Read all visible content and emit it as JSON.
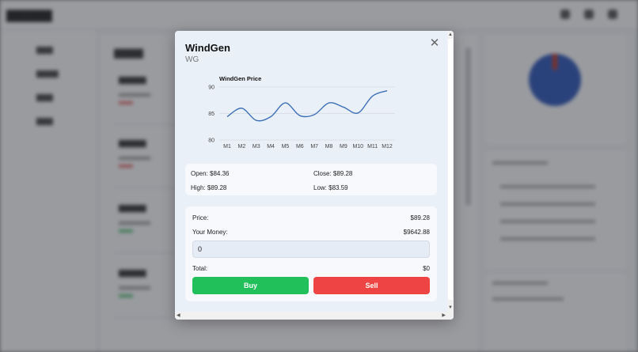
{
  "modal": {
    "title": "WindGen",
    "symbol": "WG",
    "close_glyph": "✕",
    "ohlc": {
      "open": "Open: $84.36",
      "close": "Close: $89.28",
      "high": "High: $89.28",
      "low": "Low: $83.59"
    },
    "trade": {
      "price_label": "Price:",
      "price_value": "$89.28",
      "money_label": "Your Money:",
      "money_value": "$9642.88",
      "quantity_value": "0",
      "total_label": "Total:",
      "total_value": "$0",
      "buy_label": "Buy",
      "sell_label": "Sell"
    }
  },
  "chart_data": {
    "type": "line",
    "title": "WindGen Price",
    "categories": [
      "M1",
      "M2",
      "M3",
      "M4",
      "M5",
      "M6",
      "M7",
      "M8",
      "M9",
      "M10",
      "M11",
      "M12"
    ],
    "series": [
      {
        "values": [
          84.4,
          86.0,
          83.7,
          84.4,
          87.0,
          84.6,
          84.8,
          87.0,
          86.2,
          85.1,
          88.3,
          89.3
        ]
      }
    ],
    "yticks": [
      80,
      85,
      90
    ],
    "ylim": [
      80,
      90
    ],
    "grid": true,
    "line_color": "#3d6fb8"
  }
}
